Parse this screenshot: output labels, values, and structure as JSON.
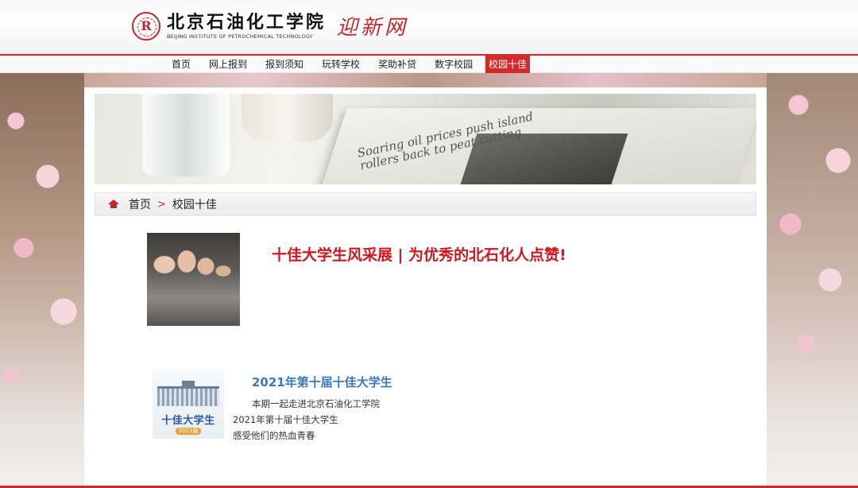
{
  "header": {
    "logo_cn": "北京石油化工学院",
    "logo_en": "BEIJING INSTITUTE OF PETROCHEMICAL TECHNOLOGY",
    "slogan": "迎新网"
  },
  "nav": {
    "items": [
      {
        "label": "首页"
      },
      {
        "label": "网上报到"
      },
      {
        "label": "报到须知"
      },
      {
        "label": "玩转学校"
      },
      {
        "label": "奖助补贷"
      },
      {
        "label": "数字校园"
      },
      {
        "label": "校园十佳",
        "active": true
      }
    ]
  },
  "breadcrumb": {
    "home": "首页",
    "separator": ">",
    "current": "校园十佳"
  },
  "articles": [
    {
      "title": "十佳大学生风采展 | 为优秀的北石化人点赞!"
    },
    {
      "thumb_text": "十佳大学生",
      "thumb_badge": "2021届",
      "title": "2021年第十届十佳大学生",
      "desc": [
        "本期一起走进北京石油化工学院",
        "2021年第十届十佳大学生",
        "感受他们的热血青春"
      ]
    }
  ],
  "banner": {
    "headline": "Soaring oil prices push island rollers back to peat cutting"
  },
  "colors": {
    "accent": "#d22a2a",
    "title_red": "#d0161e",
    "link_blue": "#3a78b8"
  }
}
